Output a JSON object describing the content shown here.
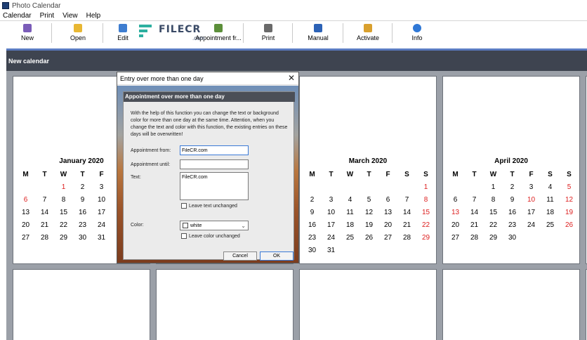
{
  "window": {
    "title": "Photo Calendar"
  },
  "menu": [
    "Calendar",
    "Print",
    "View",
    "Help"
  ],
  "toolbar": [
    {
      "label": "New",
      "icon": "calendar-new-icon",
      "color": "#7a5cb8"
    },
    {
      "label": "Open",
      "icon": "folder-icon",
      "color": "#e8b733"
    },
    {
      "label": "Edit",
      "icon": "edit-icon",
      "color": "#3e7dd0"
    },
    {
      "label": "Appointment fr...",
      "icon": "appointment-icon",
      "color": "#5c8f3a"
    },
    {
      "label": "Print",
      "icon": "printer-icon",
      "color": "#6a6a6a"
    },
    {
      "label": "Manual",
      "icon": "book-icon",
      "color": "#2c62b6"
    },
    {
      "label": "Activate",
      "icon": "lock-icon",
      "color": "#d9a02e"
    },
    {
      "label": "Info",
      "icon": "info-icon",
      "color": "#2f78d6"
    }
  ],
  "watermark": {
    "text": "FILECR",
    "sub": ".com"
  },
  "document": {
    "title": "New calendar"
  },
  "calendars": [
    {
      "title": "January 2020",
      "weekdays": [
        "M",
        "T",
        "W",
        "T",
        "F"
      ],
      "rows": [
        [
          "",
          "",
          "1",
          "2",
          "3"
        ],
        [
          "6",
          "7",
          "8",
          "9",
          "10"
        ],
        [
          "13",
          "14",
          "15",
          "16",
          "17"
        ],
        [
          "20",
          "21",
          "22",
          "23",
          "24"
        ],
        [
          "27",
          "28",
          "29",
          "30",
          "31"
        ]
      ],
      "red": [
        "1",
        "6"
      ]
    },
    {
      "title": "March 2020",
      "weekdays": [
        "M",
        "T",
        "W",
        "T",
        "F",
        "S",
        "S"
      ],
      "rows": [
        [
          "",
          "",
          "",
          "",
          "",
          "",
          "1"
        ],
        [
          "2",
          "3",
          "4",
          "5",
          "6",
          "7",
          "8"
        ],
        [
          "9",
          "10",
          "11",
          "12",
          "13",
          "14",
          "15"
        ],
        [
          "16",
          "17",
          "18",
          "19",
          "20",
          "21",
          "22"
        ],
        [
          "23",
          "24",
          "25",
          "26",
          "27",
          "28",
          "29"
        ],
        [
          "30",
          "31",
          "",
          "",
          "",
          "",
          ""
        ]
      ],
      "red": [
        "1",
        "8",
        "15",
        "22",
        "29"
      ]
    },
    {
      "title": "April 2020",
      "weekdays": [
        "M",
        "T",
        "W",
        "T",
        "F",
        "S",
        "S"
      ],
      "rows": [
        [
          "",
          "",
          "1",
          "2",
          "3",
          "4",
          "5"
        ],
        [
          "6",
          "7",
          "8",
          "9",
          "10",
          "11",
          "12"
        ],
        [
          "13",
          "14",
          "15",
          "16",
          "17",
          "18",
          "19"
        ],
        [
          "20",
          "21",
          "22",
          "23",
          "24",
          "25",
          "26"
        ],
        [
          "27",
          "28",
          "29",
          "30",
          "",
          "",
          ""
        ]
      ],
      "red": [
        "5",
        "10",
        "12",
        "13",
        "19",
        "26"
      ]
    }
  ],
  "dialog": {
    "title": "Entry over more than one day",
    "heading": "Appointment over more than one day",
    "description": "With the help of this function you can change the text or background color for more than one day at the same time. Attention, when you change the text and color with this function, the existing entries on these days will be overwritten!",
    "from_label": "Appointment from:",
    "from_value": "FileCR.com",
    "until_label": "Appointment until:",
    "until_value": "",
    "text_label": "Text:",
    "text_value": "FileCR.com",
    "leave_text": "Leave text unchanged",
    "color_label": "Color:",
    "color_value": "white",
    "leave_color": "Leave color unchanged",
    "cancel": "Cancel",
    "ok": "OK"
  }
}
